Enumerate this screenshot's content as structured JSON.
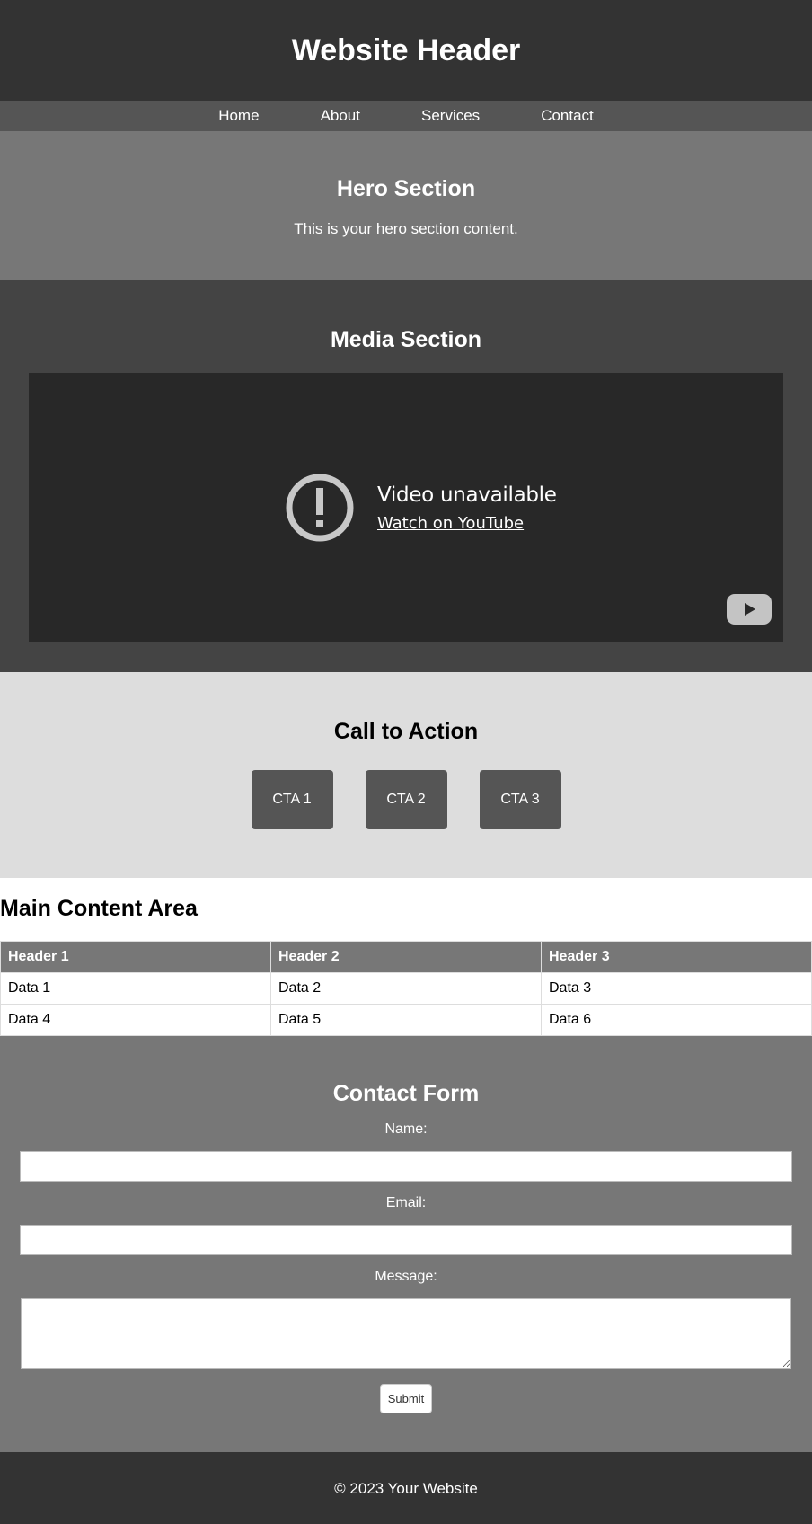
{
  "header": {
    "title": "Website Header"
  },
  "nav": {
    "items": [
      "Home",
      "About",
      "Services",
      "Contact"
    ]
  },
  "hero": {
    "title": "Hero Section",
    "text": "This is your hero section content."
  },
  "media": {
    "title": "Media Section",
    "video": {
      "status": "Video unavailable",
      "link": "Watch on YouTube",
      "icons": [
        "alert-icon",
        "youtube-logo-icon"
      ]
    }
  },
  "cta": {
    "title": "Call to Action",
    "buttons": [
      "CTA 1",
      "CTA 2",
      "CTA 3"
    ]
  },
  "main": {
    "title": "Main Content Area",
    "table": {
      "headers": [
        "Header 1",
        "Header 2",
        "Header 3"
      ],
      "rows": [
        [
          "Data 1",
          "Data 2",
          "Data 3"
        ],
        [
          "Data 4",
          "Data 5",
          "Data 6"
        ]
      ]
    }
  },
  "contact": {
    "title": "Contact Form",
    "name_label": "Name:",
    "name_value": "",
    "email_label": "Email:",
    "email_value": "",
    "message_label": "Message:",
    "message_value": "",
    "submit": "Submit"
  },
  "footer": {
    "text": "© 2023 Your Website"
  },
  "colors": {
    "header_bg": "#333333",
    "nav_bg": "#555555",
    "hero_bg": "#777777",
    "media_bg": "#444444",
    "cta_bg": "#dddddd",
    "footer_bg": "#333333"
  }
}
